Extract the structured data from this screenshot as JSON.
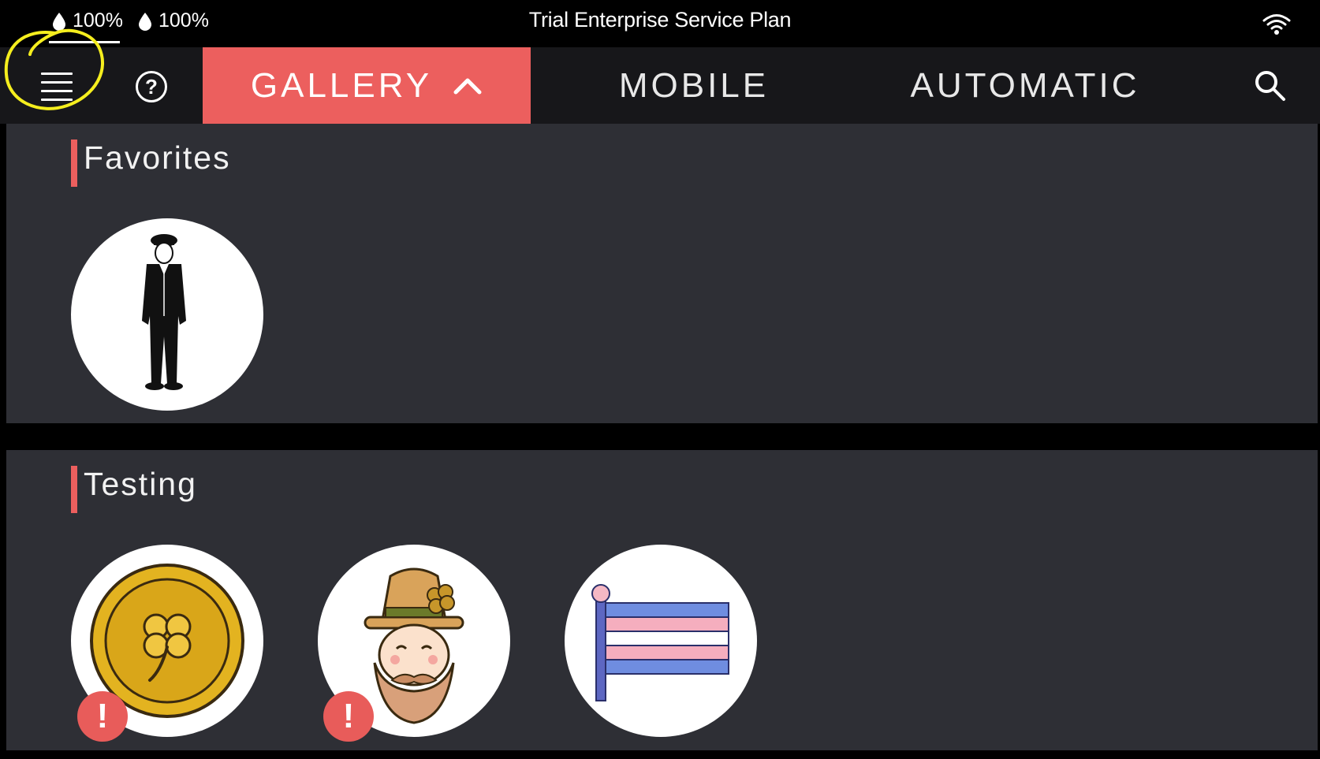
{
  "status_bar": {
    "battery_1": "100%",
    "battery_2": "100%",
    "plan_title": "Trial Enterprise Service Plan",
    "wifi_icon": "wifi-icon"
  },
  "nav": {
    "menu_icon": "hamburger-menu-icon",
    "help_icon": "help-circle-icon",
    "help_glyph": "?",
    "tabs": [
      {
        "label": "GALLERY",
        "active": true,
        "icon": "chevron-up-icon"
      },
      {
        "label": "MOBILE",
        "active": false
      },
      {
        "label": "AUTOMATIC",
        "active": false
      }
    ],
    "search_icon": "search-icon"
  },
  "sections": [
    {
      "title": "Favorites",
      "items": [
        {
          "icon": "pilot-figure-icon",
          "alert": false
        }
      ]
    },
    {
      "title": "Testing",
      "items": [
        {
          "icon": "gold-coin-clover-icon",
          "alert": true,
          "alert_glyph": "!"
        },
        {
          "icon": "leprechaun-icon",
          "alert": true,
          "alert_glyph": "!"
        },
        {
          "icon": "transgender-flag-icon",
          "alert": false
        }
      ]
    }
  ],
  "colors": {
    "accent": "#ec5f5e",
    "nav_background": "#17171a",
    "section_background": "#2e2f35",
    "annotation": "#f5ee1e"
  }
}
